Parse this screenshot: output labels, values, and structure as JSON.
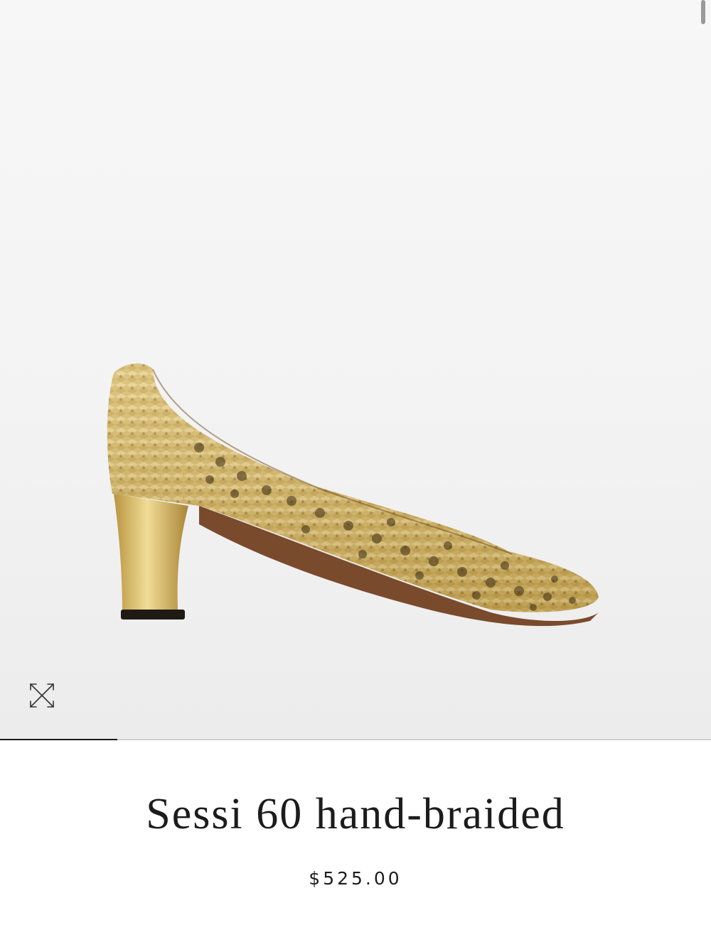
{
  "product": {
    "name": "Sessi 60 hand-braided",
    "price": "$525.00"
  },
  "gallery": {
    "image_alt": "Gold hand-braided pump with block heel",
    "expand_icon": "expand-arrows-icon",
    "progress": 0.165
  },
  "colors": {
    "gold": "#d9bc6a",
    "text": "#1c1c1c"
  }
}
